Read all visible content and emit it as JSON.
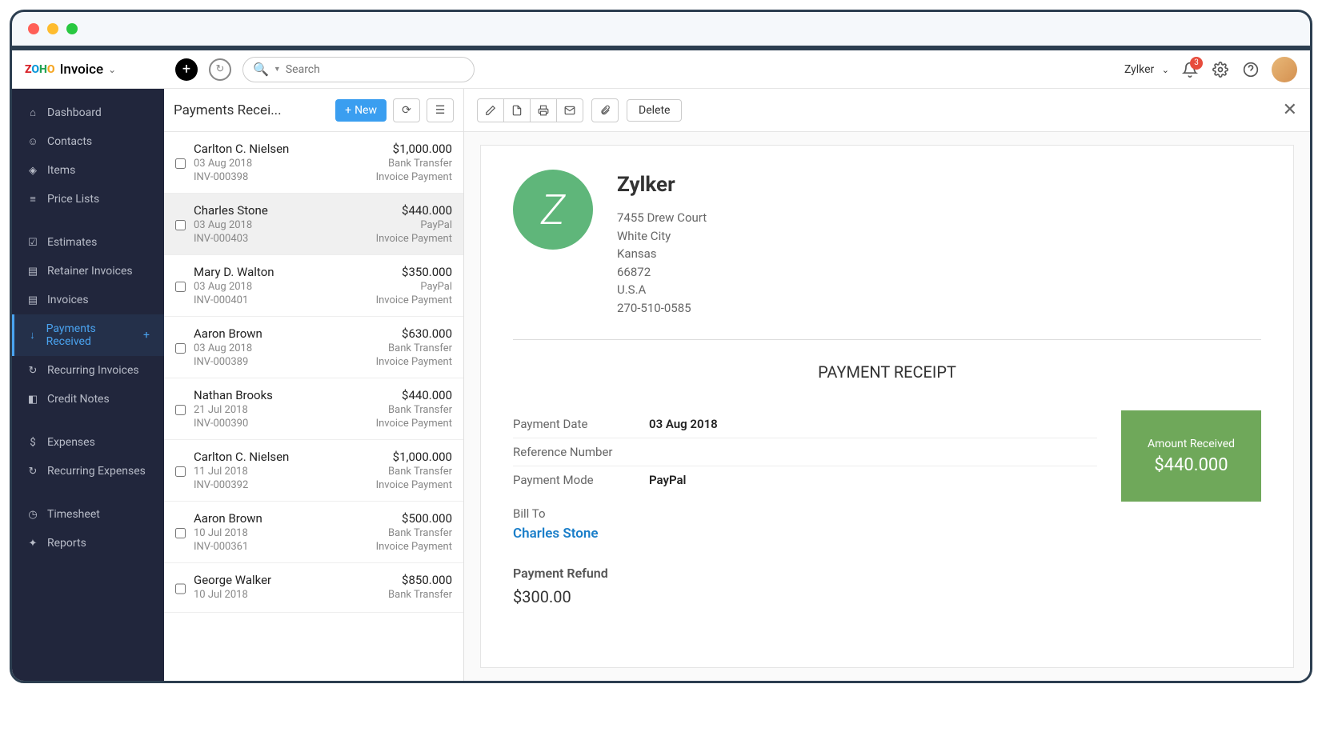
{
  "brand": {
    "logo_parts": [
      "Z",
      "O",
      "H",
      "O"
    ],
    "product": "Invoice"
  },
  "search": {
    "placeholder": "Search"
  },
  "header": {
    "org_name": "Zylker",
    "notification_count": "3"
  },
  "sidebar": {
    "items": [
      {
        "label": "Dashboard",
        "icon": "dashboard-icon"
      },
      {
        "label": "Contacts",
        "icon": "contacts-icon"
      },
      {
        "label": "Items",
        "icon": "items-icon"
      },
      {
        "label": "Price Lists",
        "icon": "pricelist-icon"
      },
      {
        "label": "Estimates",
        "icon": "estimates-icon"
      },
      {
        "label": "Retainer Invoices",
        "icon": "retainer-icon"
      },
      {
        "label": "Invoices",
        "icon": "invoices-icon"
      },
      {
        "label": "Payments Received",
        "icon": "payments-icon",
        "active": true,
        "plus": true
      },
      {
        "label": "Recurring Invoices",
        "icon": "recurring-icon"
      },
      {
        "label": "Credit Notes",
        "icon": "credit-icon"
      },
      {
        "label": "Expenses",
        "icon": "expenses-icon"
      },
      {
        "label": "Recurring Expenses",
        "icon": "recurring-exp-icon"
      },
      {
        "label": "Timesheet",
        "icon": "timesheet-icon"
      },
      {
        "label": "Reports",
        "icon": "reports-icon"
      }
    ]
  },
  "list": {
    "title": "Payments Recei...",
    "new_label": "New",
    "rows": [
      {
        "name": "Carlton C. Nielsen",
        "date": "03 Aug 2018",
        "inv": "INV-000398",
        "amount": "$1,000.000",
        "method": "Bank Transfer",
        "type": "Invoice Payment"
      },
      {
        "name": "Charles Stone",
        "date": "03 Aug 2018",
        "inv": "INV-000403",
        "amount": "$440.000",
        "method": "PayPal",
        "type": "Invoice Payment",
        "selected": true
      },
      {
        "name": "Mary D. Walton",
        "date": "03 Aug 2018",
        "inv": "INV-000401",
        "amount": "$350.000",
        "method": "PayPal",
        "type": "Invoice Payment"
      },
      {
        "name": "Aaron Brown",
        "date": "03 Aug 2018",
        "inv": "INV-000389",
        "amount": "$630.000",
        "method": "Bank Transfer",
        "type": "Invoice Payment"
      },
      {
        "name": "Nathan Brooks",
        "date": "21 Jul 2018",
        "inv": "INV-000390",
        "amount": "$440.000",
        "method": "Bank Transfer",
        "type": "Invoice Payment"
      },
      {
        "name": "Carlton C. Nielsen",
        "date": "11 Jul 2018",
        "inv": "INV-000392",
        "amount": "$1,000.000",
        "method": "Bank Transfer",
        "type": "Invoice Payment"
      },
      {
        "name": "Aaron Brown",
        "date": "10 Jul 2018",
        "inv": "INV-000361",
        "amount": "$500.000",
        "method": "Bank Transfer",
        "type": "Invoice Payment"
      },
      {
        "name": "George Walker",
        "date": "10 Jul 2018",
        "inv": "",
        "amount": "$850.000",
        "method": "Bank Transfer",
        "type": ""
      }
    ]
  },
  "toolbar": {
    "delete_label": "Delete"
  },
  "receipt": {
    "company": {
      "name": "Zylker",
      "addr1": "7455 Drew Court",
      "addr2": "White City",
      "addr3": "Kansas",
      "zip": "66872",
      "country": "U.S.A",
      "phone": "270-510-0585"
    },
    "title": "PAYMENT RECEIPT",
    "fields": {
      "date_label": "Payment Date",
      "date_value": "03 Aug 2018",
      "ref_label": "Reference Number",
      "ref_value": "",
      "mode_label": "Payment Mode",
      "mode_value": "PayPal"
    },
    "amount_box": {
      "label": "Amount Received",
      "value": "$440.000"
    },
    "billto_label": "Bill To",
    "billto_name": "Charles Stone",
    "refund_label": "Payment Refund",
    "refund_value": "$300.00"
  }
}
